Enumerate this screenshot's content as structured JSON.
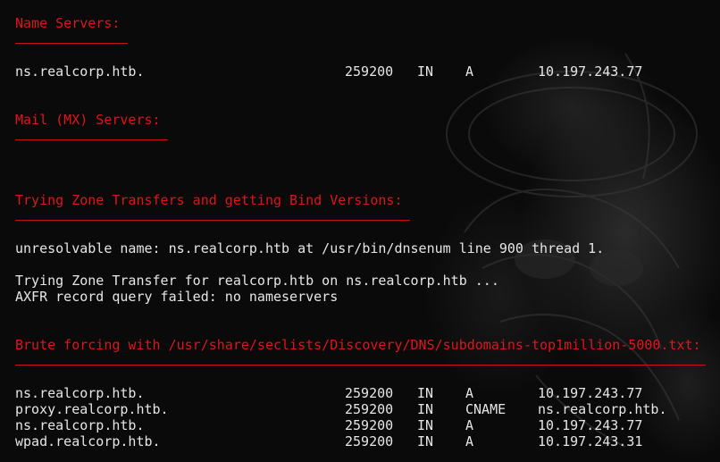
{
  "colors": {
    "heading": "#e0141b",
    "text": "#e6e6e6",
    "background": "#0a0a0a"
  },
  "sections": {
    "name_servers": {
      "heading": "Name Servers:",
      "records": [
        {
          "name": "ns.realcorp.htb.",
          "ttl": "259200",
          "class": "IN",
          "type": "A",
          "value": "10.197.243.77"
        }
      ]
    },
    "mail_servers": {
      "heading": "Mail (MX) Servers:"
    },
    "zone_transfers": {
      "heading": "Trying Zone Transfers and getting Bind Versions:",
      "lines": [
        "unresolvable name: ns.realcorp.htb at /usr/bin/dnsenum line 900 thread 1.",
        "Trying Zone Transfer for realcorp.htb on ns.realcorp.htb ...",
        "AXFR record query failed: no nameservers"
      ]
    },
    "brute_force": {
      "heading": "Brute forcing with /usr/share/seclists/Discovery/DNS/subdomains-top1million-5000.txt:",
      "records": [
        {
          "name": "ns.realcorp.htb.",
          "ttl": "259200",
          "class": "IN",
          "type": "A",
          "value": "10.197.243.77"
        },
        {
          "name": "proxy.realcorp.htb.",
          "ttl": "259200",
          "class": "IN",
          "type": "CNAME",
          "value": "ns.realcorp.htb."
        },
        {
          "name": "ns.realcorp.htb.",
          "ttl": "259200",
          "class": "IN",
          "type": "A",
          "value": "10.197.243.77"
        },
        {
          "name": "wpad.realcorp.htb.",
          "ttl": "259200",
          "class": "IN",
          "type": "A",
          "value": "10.197.243.31"
        }
      ]
    }
  }
}
